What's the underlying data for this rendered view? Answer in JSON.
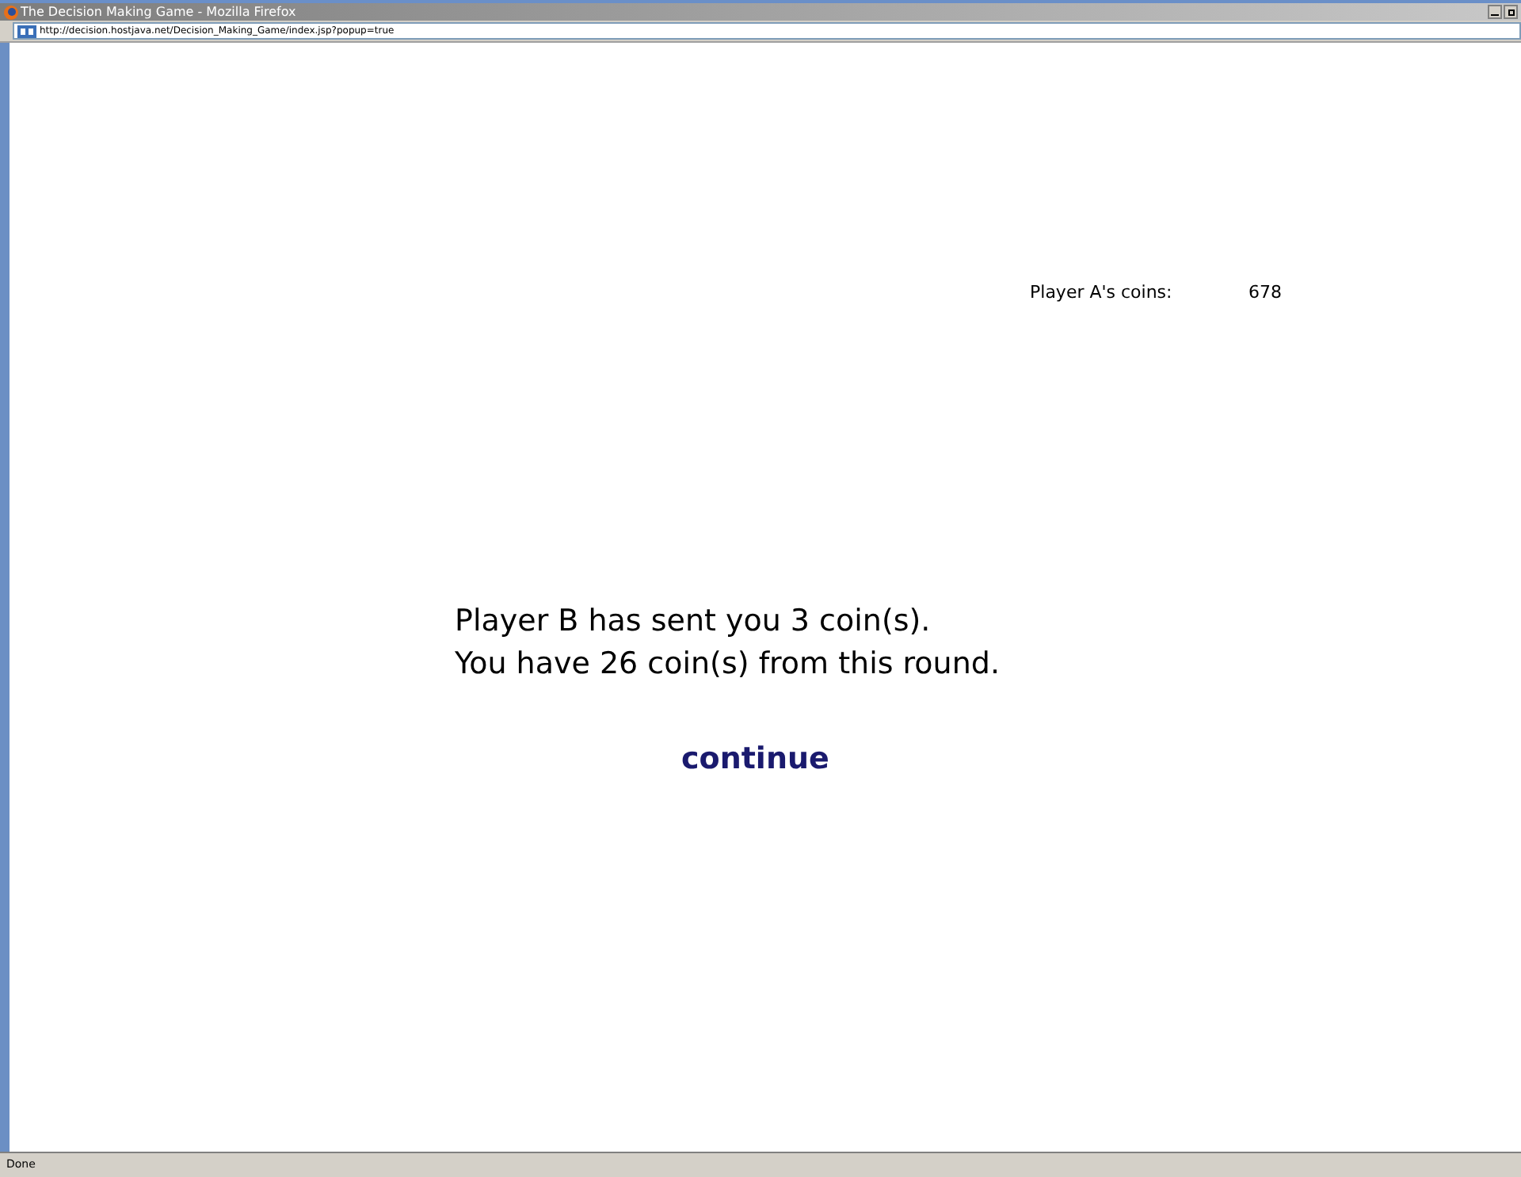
{
  "window": {
    "title": "The Decision Making Game - Mozilla Firefox"
  },
  "address_bar": {
    "url": "http://decision.hostjava.net/Decision_Making_Game/index.jsp?popup=true"
  },
  "score": {
    "label": "Player A's coins:",
    "value": "678"
  },
  "message": [
    "Player B has sent you 3 coin(s).",
    "You have 26 coin(s) from this round."
  ],
  "continue_link": "continue",
  "status_bar": "Done"
}
